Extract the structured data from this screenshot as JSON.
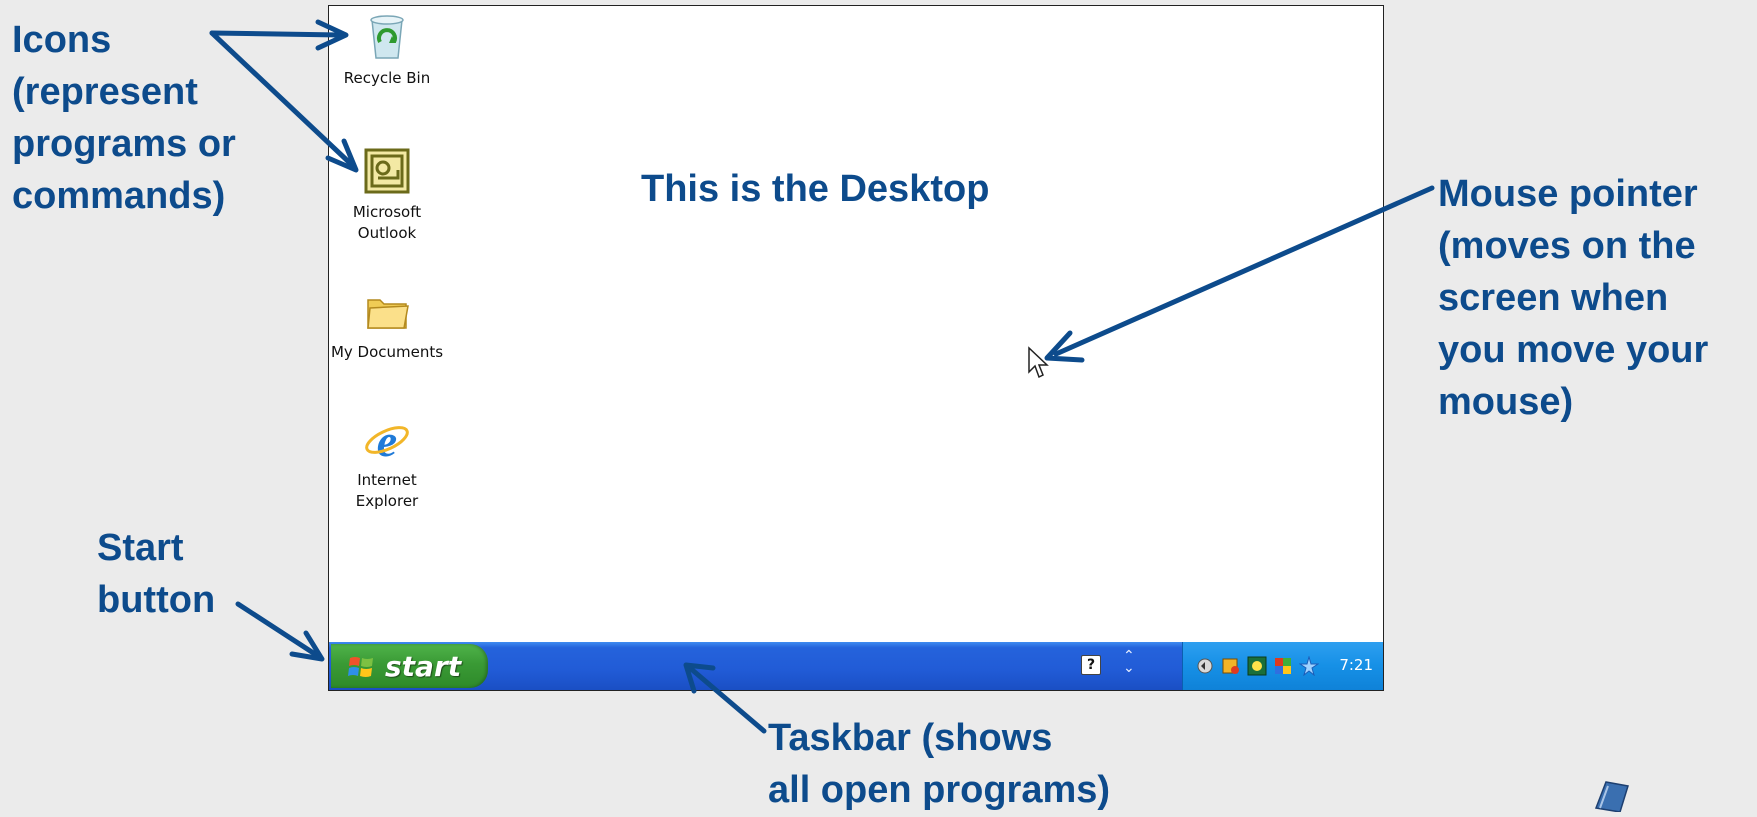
{
  "annotations": {
    "icons": [
      "Icons",
      "(represent",
      "programs or",
      "commands)"
    ],
    "mouse_pointer": [
      "Mouse pointer",
      "(moves on the",
      "screen when",
      "you move your",
      "mouse)"
    ],
    "start_button": [
      "Start",
      "button"
    ],
    "taskbar": [
      "Taskbar (shows",
      "all open programs)"
    ]
  },
  "desktop": {
    "title": "This is the Desktop",
    "icons": [
      {
        "label": [
          "Recycle Bin"
        ],
        "icon": "recycle-bin-icon"
      },
      {
        "label": [
          "Microsoft",
          "Outlook"
        ],
        "icon": "outlook-icon"
      },
      {
        "label": [
          "My Documents"
        ],
        "icon": "folder-icon"
      },
      {
        "label": [
          "Internet",
          "Explorer"
        ],
        "icon": "internet-explorer-icon"
      }
    ]
  },
  "taskbar": {
    "start_label": "start",
    "help_label": "?",
    "clock": "7:21"
  },
  "colors": {
    "annotation": "#0d4b8c",
    "taskbar": "#215bd6",
    "start_button": "#3a9a35",
    "tray": "#1690e6"
  }
}
